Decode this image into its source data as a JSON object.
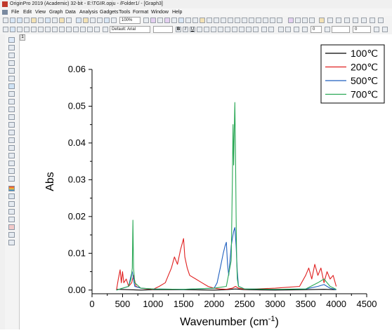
{
  "window": {
    "title": "OriginPro 2019 (Academic) 32-bit - E:\\TGIR.opju - /Folder1/ - [Graph3]"
  },
  "menu": {
    "items": [
      "File",
      "Edit",
      "View",
      "Graph",
      "Data",
      "Analysis",
      "Gadgets",
      "Tools",
      "Format",
      "Window",
      "Help"
    ]
  },
  "toolbar": {
    "zoom_value": "100%",
    "font_value": "Default: Arial",
    "bold_label": "B",
    "italic_label": "I",
    "underline_label": "U",
    "size_value_1": "0",
    "size_value_2": "0"
  },
  "graph": {
    "layer_number": "1"
  },
  "chart_data": {
    "type": "line",
    "xlabel": "Wavenumber (cm",
    "xlabel_sup": "-1",
    "xlabel_end": ")",
    "ylabel": "Abs",
    "xlim": [
      0,
      4500
    ],
    "ylim": [
      -0.001,
      0.06
    ],
    "x_ticks": [
      0,
      500,
      1000,
      1500,
      2000,
      2500,
      3000,
      3500,
      4000,
      4500
    ],
    "x_tick_labels": [
      "0",
      "500",
      "1000",
      "1500",
      "2000",
      "2500",
      "3000",
      "3500",
      "4000",
      "4500"
    ],
    "y_ticks": [
      0,
      0.01,
      0.02,
      0.03,
      0.04,
      0.05,
      0.06
    ],
    "y_tick_labels": [
      "0.00",
      "0.01",
      "0.02",
      "0.03",
      "0.04",
      "0.05",
      "0.06"
    ],
    "legend_position": "top-right",
    "grid": false,
    "series": [
      {
        "name": "100℃",
        "color": "#000000",
        "x": [
          400,
          600,
          800,
          1000,
          1500,
          2000,
          2200,
          2350,
          2500,
          3000,
          3500,
          3800,
          4000
        ],
        "y": [
          0.0002,
          0.0001,
          0.0,
          0.0001,
          0.0001,
          0.0,
          0.0001,
          0.0003,
          0.0001,
          0.0,
          0.0001,
          0.0002,
          0.0001
        ]
      },
      {
        "name": "200℃",
        "color": "#e02020",
        "x": [
          400,
          430,
          460,
          480,
          500,
          520,
          560,
          600,
          650,
          680,
          720,
          800,
          900,
          1000,
          1100,
          1200,
          1250,
          1300,
          1350,
          1400,
          1450,
          1500,
          1520,
          1560,
          1600,
          1700,
          1800,
          1900,
          2000,
          2100,
          2200,
          2300,
          2350,
          2400,
          2500,
          3000,
          3400,
          3500,
          3550,
          3600,
          3650,
          3700,
          3750,
          3800,
          3850,
          3900,
          3950,
          4000
        ],
        "y": [
          0.0,
          0.003,
          0.0055,
          0.002,
          0.005,
          0.002,
          0.003,
          0.001,
          0.002,
          0.004,
          0.001,
          0.0005,
          0.0003,
          0.0002,
          0.001,
          0.002,
          0.004,
          0.006,
          0.009,
          0.007,
          0.011,
          0.014,
          0.009,
          0.006,
          0.004,
          0.003,
          0.002,
          0.001,
          0.0005,
          0.0003,
          0.0002,
          0.0005,
          0.001,
          0.0005,
          0.0002,
          0.0005,
          0.001,
          0.004,
          0.006,
          0.003,
          0.007,
          0.004,
          0.006,
          0.002,
          0.005,
          0.003,
          0.004,
          0.001
        ]
      },
      {
        "name": "500℃",
        "color": "#1f5fbf",
        "x": [
          400,
          500,
          600,
          640,
          660,
          680,
          700,
          800,
          1000,
          1500,
          2000,
          2050,
          2100,
          2150,
          2180,
          2200,
          2220,
          2240,
          2260,
          2280,
          2300,
          2320,
          2340,
          2360,
          2380,
          2400,
          2500,
          3000,
          3500,
          3700,
          3800,
          3900,
          4000
        ],
        "y": [
          0.0,
          0.0005,
          0.001,
          0.004,
          0.005,
          0.003,
          0.001,
          0.0005,
          0.0003,
          0.0002,
          0.0005,
          0.002,
          0.006,
          0.01,
          0.012,
          0.013,
          0.007,
          0.004,
          0.008,
          0.012,
          0.014,
          0.016,
          0.017,
          0.012,
          0.005,
          0.001,
          0.0003,
          0.0002,
          0.0003,
          0.001,
          0.0015,
          0.0005,
          0.0001
        ]
      },
      {
        "name": "700℃",
        "color": "#2aa855",
        "x": [
          400,
          500,
          600,
          640,
          660,
          670,
          680,
          700,
          800,
          1000,
          1500,
          2000,
          2200,
          2280,
          2300,
          2310,
          2320,
          2330,
          2340,
          2350,
          2360,
          2370,
          2380,
          2400,
          2500,
          3000,
          3500,
          3700,
          3800,
          3900,
          4000
        ],
        "y": [
          0.0,
          0.0005,
          0.001,
          0.003,
          0.006,
          0.019,
          0.006,
          0.002,
          0.0005,
          0.0003,
          0.0002,
          0.0005,
          0.001,
          0.008,
          0.03,
          0.045,
          0.034,
          0.044,
          0.051,
          0.038,
          0.02,
          0.008,
          0.003,
          0.001,
          0.0003,
          0.0002,
          0.0003,
          0.002,
          0.003,
          0.001,
          0.0002
        ]
      }
    ]
  }
}
